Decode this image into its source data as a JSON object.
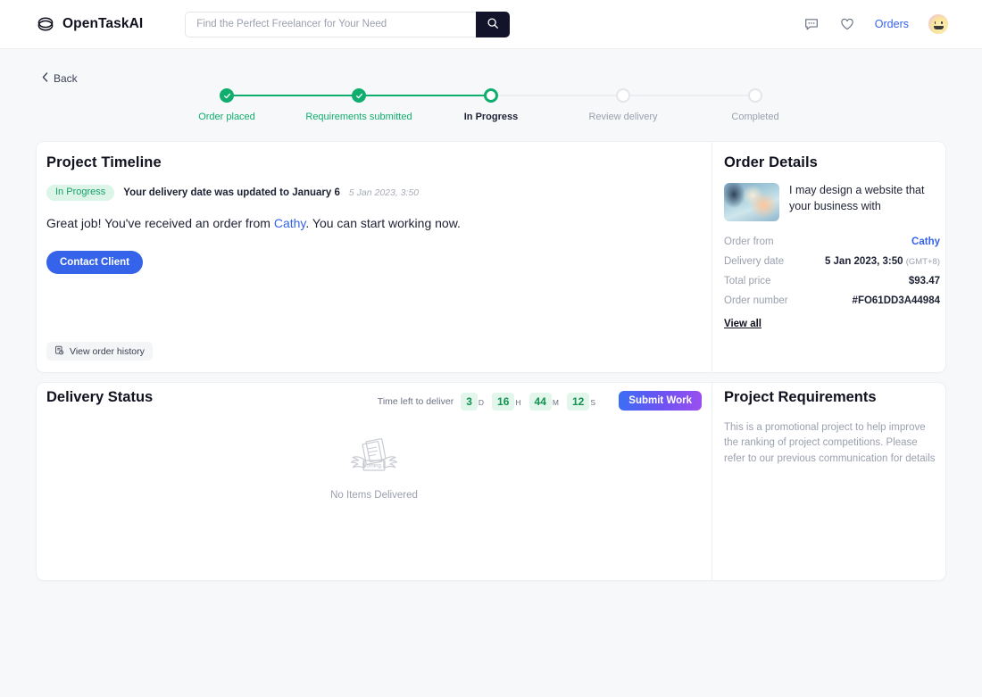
{
  "header": {
    "brand": "OpenTaskAI",
    "logo_icon": "overlapping-ellipses-logo-icon",
    "search": {
      "placeholder": "Find the Perfect Freelancer for Your Need",
      "value": "",
      "button_icon": "search-icon"
    },
    "chat_icon": "chat-bubble-icon",
    "wishlist_icon": "heart-icon",
    "orders_label": "Orders",
    "avatar_icon": "user-avatar-smiley"
  },
  "back": {
    "label": "Back",
    "icon": "chevron-left-icon"
  },
  "stepper": {
    "steps": [
      {
        "label": "Order placed",
        "state": "done"
      },
      {
        "label": "Requirements submitted",
        "state": "done"
      },
      {
        "label": "In Progress",
        "state": "current"
      },
      {
        "label": "Review delivery",
        "state": "todo"
      },
      {
        "label": "Completed",
        "state": "todo"
      }
    ],
    "done_color": "#0fae6e",
    "todo_color": "#e3e5e9"
  },
  "project_timeline": {
    "title": "Project Timeline",
    "status_badge": "In Progress",
    "update_text": "Your delivery date was updated to January 6",
    "update_time": "5 Jan 2023, 3:50",
    "message_prefix": "Great job! You've received an order from ",
    "message_link": "Cathy",
    "message_suffix": ". You can start working now.",
    "contact_button": "Contact Client",
    "history_button": "View order history",
    "history_icon": "order-history-icon"
  },
  "order_details": {
    "title": "Order Details",
    "product_name": "I may design a website that your business with",
    "thumbnail_icon": "order-thumbnail-image",
    "rows": [
      {
        "key": "Order from",
        "value": "Cathy",
        "link": true
      },
      {
        "key": "Delivery date",
        "value": "5 Jan 2023, 3:50",
        "suffix": "(GMT+8)"
      },
      {
        "key": "Total price",
        "value": "$93.47"
      },
      {
        "key": "Order number",
        "value": "#FO61DD3A44984"
      }
    ],
    "view_all": "View all"
  },
  "delivery_status": {
    "title": "Delivery Status",
    "timer_label": "Time left to deliver",
    "timer": [
      {
        "value": "3",
        "unit": "D"
      },
      {
        "value": "16",
        "unit": "H"
      },
      {
        "value": "44",
        "unit": "M"
      },
      {
        "value": "12",
        "unit": "S"
      }
    ],
    "submit_button": "Submit Work",
    "empty_icon": "winged-papers-nothing-icon",
    "empty_text": "No Items Delivered",
    "submit_gradient_from": "#3b6ef5",
    "submit_gradient_to": "#9b4ff0"
  },
  "project_requirements": {
    "title": "Project Requirements",
    "body": "This is a promotional project to help improve the ranking of project competitions. Please refer to our previous communication for details"
  }
}
